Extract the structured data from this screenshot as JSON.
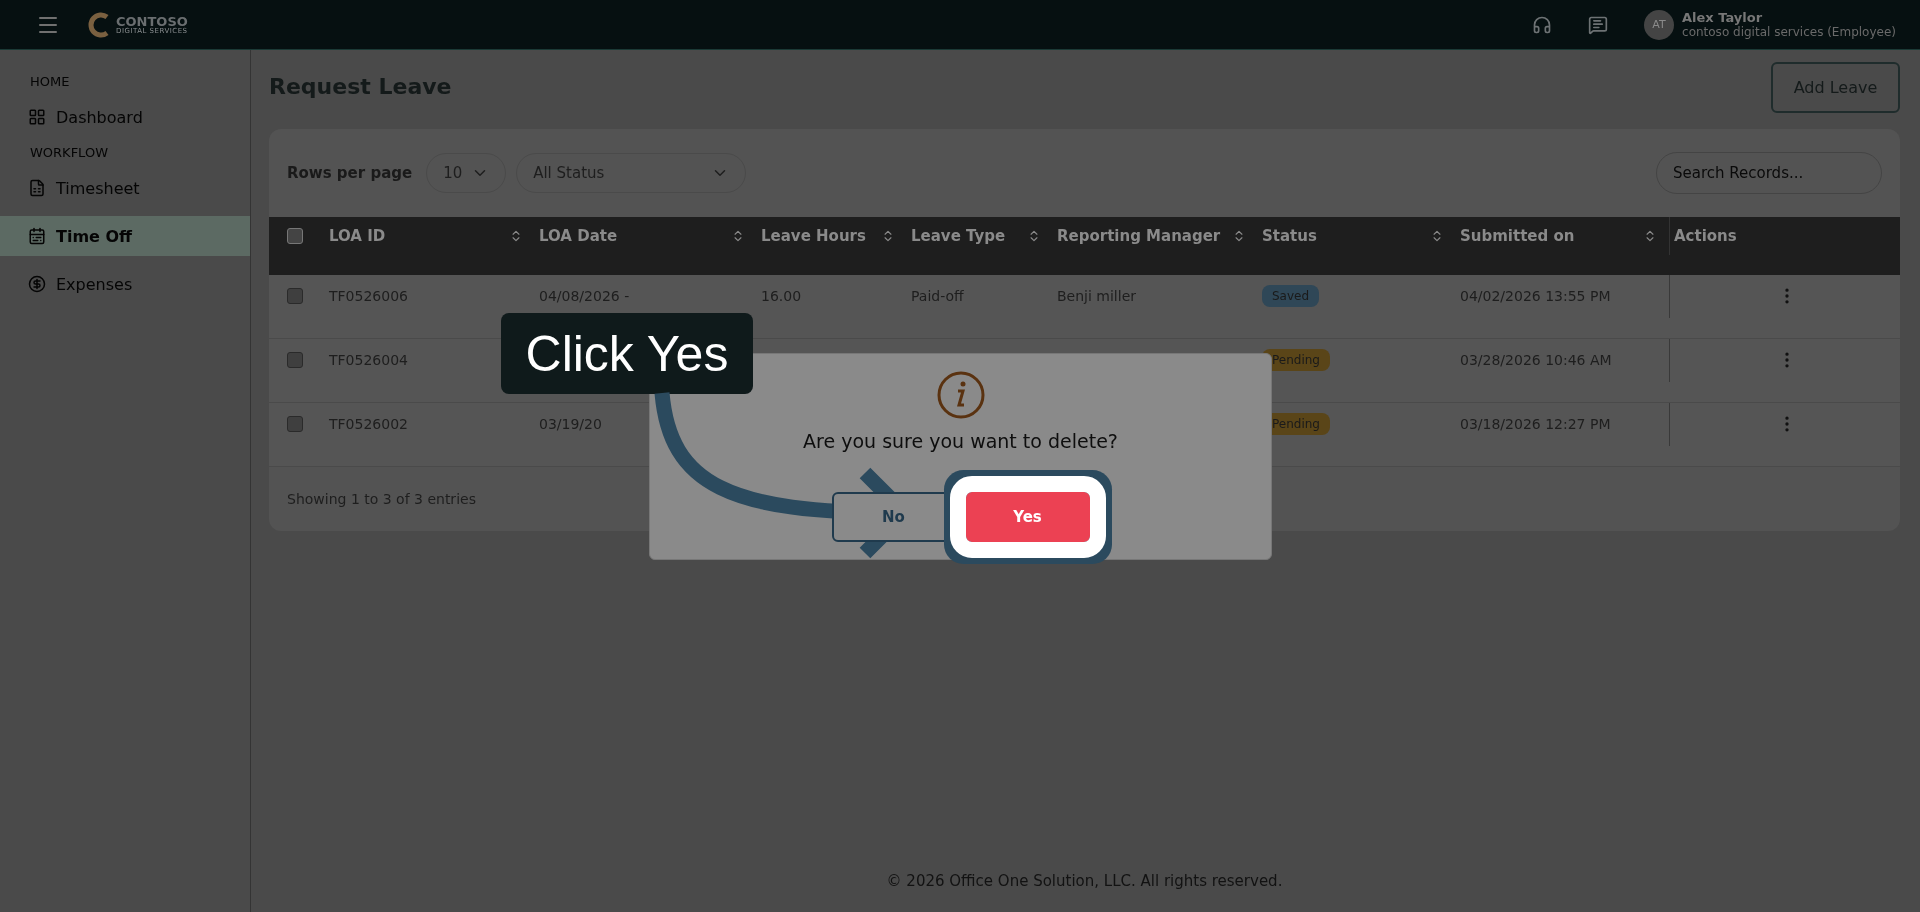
{
  "topbar": {
    "brand": "CONTOSO",
    "brand_sub": "DIGITAL SERVICES",
    "user": {
      "initials": "AT",
      "name": "Alex Taylor",
      "org": "contoso digital services (Employee)"
    }
  },
  "sidebar": {
    "sections": [
      {
        "heading": "HOME",
        "items": [
          {
            "label": "Dashboard",
            "selected": false
          }
        ]
      },
      {
        "heading": "WORKFLOW",
        "items": [
          {
            "label": "Timesheet",
            "selected": false
          },
          {
            "label": "Time Off",
            "selected": true
          },
          {
            "label": "Expenses",
            "selected": false
          }
        ]
      }
    ]
  },
  "page": {
    "title": "Request Leave",
    "add_button": "Add Leave"
  },
  "filters": {
    "rows_label": "Rows per page",
    "rows_value": "10",
    "status_value": "All Status",
    "search_placeholder": "Search Records..."
  },
  "table": {
    "select_all": {
      "checked": false
    },
    "columns": [
      {
        "label": "LOA ID",
        "sortable": true
      },
      {
        "label": "LOA Date",
        "sortable": true
      },
      {
        "label": "Leave Hours",
        "sortable": true
      },
      {
        "label": "Leave Type",
        "sortable": true
      },
      {
        "label": "Reporting Manager",
        "sortable": true
      },
      {
        "label": "Status",
        "sortable": true
      },
      {
        "label": "Submitted on",
        "sortable": true
      },
      {
        "label": "Actions",
        "sortable": false
      }
    ],
    "rows": [
      {
        "checked": false,
        "loa_id": "TF0526006",
        "loa_date": "04/08/2026 -",
        "leave_hours": "16.00",
        "leave_type": "Paid-off",
        "manager": "Benji miller",
        "status": {
          "label": "Saved",
          "kind": "saved"
        },
        "submitted": "04/02/2026 13:55 PM"
      },
      {
        "checked": false,
        "loa_id": "TF0526004",
        "status": {
          "label": "Pending",
          "kind": "pending"
        },
        "submitted": "03/28/2026 10:46 AM"
      },
      {
        "checked": false,
        "loa_id": "TF0526002",
        "loa_date": "03/19/20",
        "status": {
          "label": "Pending",
          "kind": "pending"
        },
        "submitted": "03/18/2026 12:27 PM"
      }
    ]
  },
  "footer": "Showing 1 to 3 of 3 entries",
  "copyright": "© 2026 Office One Solution, LLC. All rights reserved.",
  "dialog": {
    "message": "Are you sure you want to delete?",
    "buttons": [
      {
        "label": "No",
        "kind": "secondary"
      },
      {
        "label": "Yes",
        "kind": "primary"
      }
    ]
  },
  "callout": {
    "text": "Click Yes"
  }
}
